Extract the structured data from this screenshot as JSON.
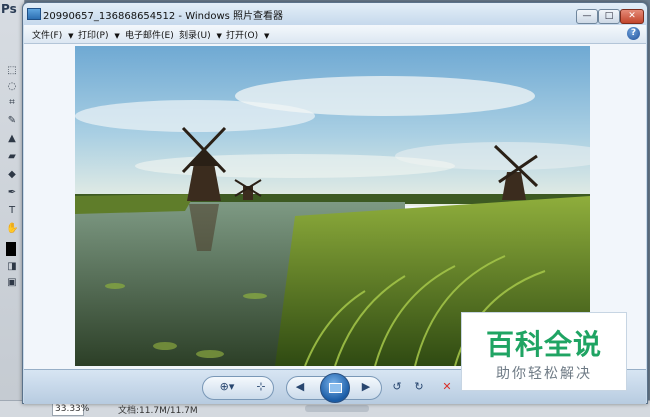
{
  "window": {
    "title": "20990657_136868654512 - Windows 照片查看器",
    "buttons": {
      "minimize": "—",
      "maximize": "□",
      "close": "✕"
    },
    "help_icon": "?"
  },
  "menubar": {
    "items": [
      {
        "label": "文件(F)",
        "dropdown": "▼"
      },
      {
        "label": "打印(P)",
        "dropdown": "▼"
      },
      {
        "label": "电子邮件(E)"
      },
      {
        "label": "刻录(U)",
        "dropdown": "▼"
      },
      {
        "label": "打开(O)",
        "dropdown": "▼"
      }
    ]
  },
  "toolbar": {
    "zoom": "⊕▾",
    "actual_size": "⊹",
    "prev": "◀",
    "next": "▶",
    "rotate_ccw": "↺",
    "rotate_cw": "↻",
    "delete": "✕"
  },
  "photoshop": {
    "logo": "Ps",
    "zoom": "33.33%",
    "doc": "文档:11.7M/11.7M"
  },
  "watermark": {
    "main": "百科全说",
    "sub": "助你轻松解决"
  },
  "colors": {
    "accent": "#1fa463",
    "delete": "#d9312b",
    "toolbar_blue": "#28466f"
  }
}
